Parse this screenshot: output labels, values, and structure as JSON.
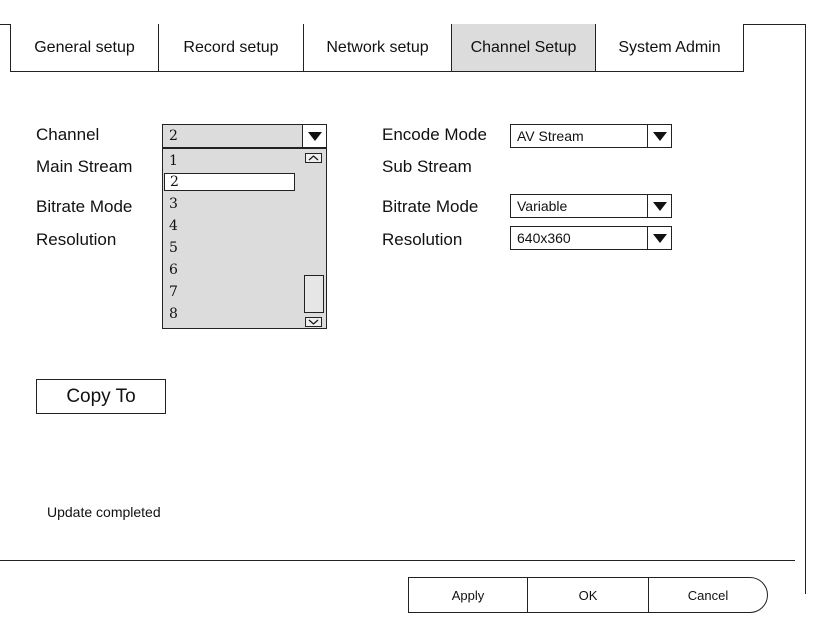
{
  "tabs": [
    {
      "label": "General setup"
    },
    {
      "label": "Record setup"
    },
    {
      "label": "Network setup"
    },
    {
      "label": "Channel Setup"
    },
    {
      "label": "System Admin"
    }
  ],
  "active_tab": "Channel Setup",
  "left": {
    "channel_label": "Channel",
    "channel_value": "2",
    "main_stream_label": "Main Stream",
    "bitrate_mode_label": "Bitrate Mode",
    "resolution_label": "Resolution"
  },
  "channel_dropdown": {
    "options": [
      "1",
      "2",
      "3",
      "4",
      "5",
      "6",
      "7",
      "8"
    ],
    "selected": "2"
  },
  "right": {
    "encode_mode_label": "Encode Mode",
    "encode_mode_value": "AV Stream",
    "sub_stream_label": "Sub Stream",
    "bitrate_mode_label": "Bitrate Mode",
    "bitrate_mode_value": "Variable",
    "resolution_label": "Resolution",
    "resolution_value": "640x360"
  },
  "copy_to_label": "Copy To",
  "status_text": "Update completed",
  "footer": {
    "apply_label": "Apply",
    "ok_label": "OK",
    "cancel_label": "Cancel"
  },
  "icons": {
    "dropdown_arrow": "down-triangle-icon",
    "scroll_up": "chevron-up-icon",
    "scroll_down": "chevron-down-icon"
  }
}
